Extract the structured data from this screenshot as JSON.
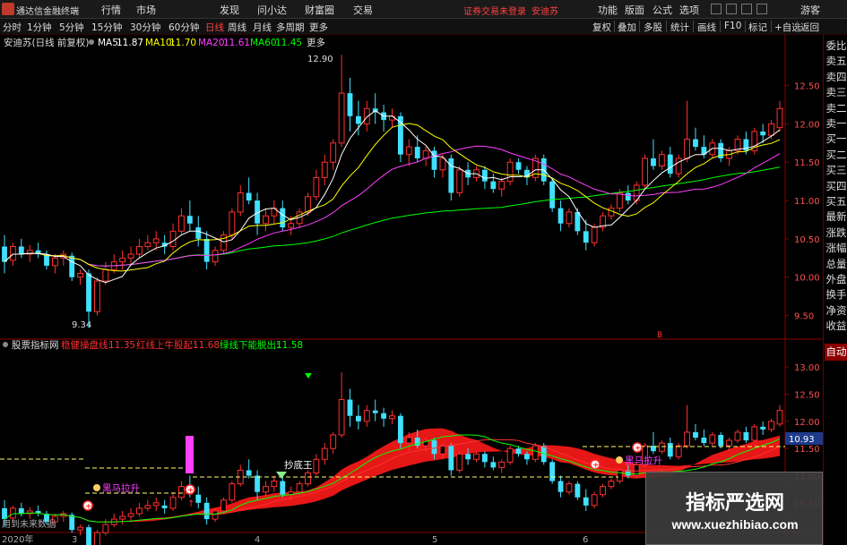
{
  "menubar": {
    "app_name": "通达信金融终端",
    "items": [
      "行情",
      "市场",
      "发现",
      "问小达",
      "财富圈",
      "交易"
    ],
    "notice": "证券交易未登录",
    "stock_name": "安迪苏",
    "right_items": [
      "功能",
      "版面",
      "公式",
      "选项"
    ],
    "guest": "游客"
  },
  "toolbar": {
    "timeframes": [
      "分时",
      "1分钟",
      "5分钟",
      "15分钟",
      "30分钟",
      "60分钟",
      "日线",
      "周线",
      "月线",
      "多周期",
      "更多"
    ],
    "active": "日线",
    "buttons": [
      "复权",
      "叠加",
      "多股",
      "统计",
      "画线",
      "F10",
      "标记",
      "+自选",
      "返回"
    ]
  },
  "main_chart": {
    "title": "安迪苏(日线 前复权)",
    "ma": [
      {
        "label": "MA5:",
        "value": "11.87",
        "color": "#ffffff"
      },
      {
        "label": "MA10:",
        "value": "11.70",
        "color": "#ffff00"
      },
      {
        "label": "MA20:",
        "value": "11.61",
        "color": "#ff40ff"
      },
      {
        "label": "MA60:",
        "value": "11.45",
        "color": "#00ff00"
      }
    ],
    "high_label": "12.90",
    "low_label": "9.34",
    "y_ticks": [
      "12.50",
      "12.00",
      "11.50",
      "11.00",
      "10.50",
      "10.00",
      "9.50"
    ],
    "marker": "B"
  },
  "indicator": {
    "title": "股票指标网",
    "lines": [
      {
        "label": "稳健操盘线:",
        "value": "11.35",
        "color": "#ff3030"
      },
      {
        "label": "红线上牛股起:",
        "value": "11.68",
        "color": "#ff3030"
      },
      {
        "label": "绿线下能脱出:",
        "value": "11.58",
        "color": "#00ff00"
      }
    ],
    "y_ticks": [
      "13.00",
      "12.50",
      "12.00",
      "11.50",
      "11.00",
      "10.50"
    ],
    "current_value": "10.93",
    "signals": [
      "抄底王",
      "黑马拉升",
      "黑马拉升"
    ]
  },
  "footer": {
    "note": "用到未来数据",
    "year": "2020年",
    "months": [
      "3",
      "4",
      "5",
      "6"
    ]
  },
  "right_panel": [
    "委比",
    "卖五",
    "卖四",
    "卖三",
    "卖二",
    "卖一",
    "买一",
    "买二",
    "买三",
    "买四",
    "买五",
    "最新",
    "涨跌",
    "涨幅",
    "总量",
    "外盘",
    "换手",
    "净资",
    "收益",
    "自动"
  ],
  "watermark": {
    "title": "指标严选网",
    "url": "www.xuezhibiao.com"
  },
  "colors": {
    "up": "#ff3030",
    "down": "#40e0ff",
    "ma5": "#ffffff",
    "ma10": "#ffff00",
    "ma20": "#ff40ff",
    "ma60": "#00ff00"
  },
  "chart_data": {
    "type": "candlestick",
    "ohlc": [
      [
        10.4,
        10.55,
        10.05,
        10.2
      ],
      [
        10.22,
        10.45,
        10.15,
        10.4
      ],
      [
        10.4,
        10.5,
        10.25,
        10.3
      ],
      [
        10.3,
        10.42,
        10.2,
        10.35
      ],
      [
        10.35,
        10.45,
        10.25,
        10.3
      ],
      [
        10.3,
        10.35,
        10.1,
        10.15
      ],
      [
        10.15,
        10.3,
        10.05,
        10.25
      ],
      [
        10.25,
        10.35,
        10.15,
        10.3
      ],
      [
        10.28,
        10.32,
        9.95,
        10.0
      ],
      [
        10.0,
        10.1,
        9.9,
        10.05
      ],
      [
        10.05,
        10.1,
        9.34,
        9.55
      ],
      [
        9.55,
        10.0,
        9.5,
        9.95
      ],
      [
        9.95,
        10.2,
        9.9,
        10.1
      ],
      [
        10.1,
        10.3,
        10.05,
        10.2
      ],
      [
        10.2,
        10.35,
        10.1,
        10.25
      ],
      [
        10.25,
        10.4,
        10.15,
        10.3
      ],
      [
        10.3,
        10.5,
        10.25,
        10.4
      ],
      [
        10.4,
        10.55,
        10.35,
        10.45
      ],
      [
        10.45,
        10.6,
        10.35,
        10.5
      ],
      [
        10.45,
        10.55,
        10.3,
        10.4
      ],
      [
        10.4,
        10.7,
        10.35,
        10.6
      ],
      [
        10.6,
        10.9,
        10.55,
        10.8
      ],
      [
        10.8,
        11.0,
        10.6,
        10.7
      ],
      [
        10.65,
        10.8,
        10.4,
        10.5
      ],
      [
        10.5,
        10.6,
        10.1,
        10.2
      ],
      [
        10.2,
        10.4,
        10.15,
        10.35
      ],
      [
        10.35,
        10.6,
        10.3,
        10.55
      ],
      [
        10.55,
        10.9,
        10.5,
        10.85
      ],
      [
        10.85,
        11.2,
        10.8,
        11.1
      ],
      [
        11.1,
        11.3,
        10.95,
        11.0
      ],
      [
        11.0,
        11.1,
        10.55,
        10.7
      ],
      [
        10.7,
        10.9,
        10.6,
        10.8
      ],
      [
        10.8,
        11.0,
        10.7,
        10.9
      ],
      [
        10.9,
        11.0,
        10.6,
        10.65
      ],
      [
        10.65,
        10.8,
        10.55,
        10.7
      ],
      [
        10.7,
        10.9,
        10.65,
        10.85
      ],
      [
        10.85,
        11.1,
        10.8,
        11.05
      ],
      [
        11.05,
        11.4,
        11.0,
        11.3
      ],
      [
        11.3,
        11.6,
        11.2,
        11.5
      ],
      [
        11.5,
        11.8,
        11.4,
        11.75
      ],
      [
        11.75,
        12.9,
        11.7,
        12.4
      ],
      [
        12.4,
        12.6,
        11.9,
        12.1
      ],
      [
        12.1,
        12.3,
        11.85,
        12.0
      ],
      [
        12.0,
        12.3,
        11.9,
        12.2
      ],
      [
        12.2,
        12.4,
        12.0,
        12.15
      ],
      [
        12.15,
        12.25,
        11.9,
        12.05
      ],
      [
        12.05,
        12.2,
        11.95,
        12.1
      ],
      [
        12.1,
        12.15,
        11.5,
        11.6
      ],
      [
        11.6,
        11.8,
        11.45,
        11.7
      ],
      [
        11.7,
        11.85,
        11.5,
        11.55
      ],
      [
        11.55,
        11.7,
        11.45,
        11.65
      ],
      [
        11.65,
        11.7,
        11.3,
        11.4
      ],
      [
        11.4,
        11.6,
        11.3,
        11.55
      ],
      [
        11.55,
        11.6,
        11.0,
        11.1
      ],
      [
        11.1,
        11.45,
        11.05,
        11.4
      ],
      [
        11.4,
        11.5,
        11.2,
        11.3
      ],
      [
        11.3,
        11.45,
        11.25,
        11.4
      ],
      [
        11.4,
        11.45,
        11.15,
        11.25
      ],
      [
        11.25,
        11.35,
        11.1,
        11.15
      ],
      [
        11.15,
        11.3,
        11.05,
        11.25
      ],
      [
        11.25,
        11.55,
        11.2,
        11.5
      ],
      [
        11.5,
        11.55,
        11.35,
        11.4
      ],
      [
        11.4,
        11.45,
        11.2,
        11.3
      ],
      [
        11.3,
        11.6,
        11.25,
        11.55
      ],
      [
        11.55,
        11.6,
        11.2,
        11.25
      ],
      [
        11.25,
        11.3,
        10.85,
        10.9
      ],
      [
        10.9,
        11.0,
        10.6,
        10.7
      ],
      [
        10.7,
        10.9,
        10.65,
        10.85
      ],
      [
        10.85,
        10.9,
        10.55,
        10.6
      ],
      [
        10.6,
        10.75,
        10.35,
        10.45
      ],
      [
        10.45,
        10.7,
        10.4,
        10.65
      ],
      [
        10.65,
        10.85,
        10.6,
        10.8
      ],
      [
        10.8,
        10.95,
        10.75,
        10.9
      ],
      [
        10.9,
        11.15,
        10.85,
        11.1
      ],
      [
        11.1,
        11.2,
        10.95,
        11.0
      ],
      [
        11.0,
        11.25,
        10.95,
        11.2
      ],
      [
        11.2,
        11.6,
        11.15,
        11.55
      ],
      [
        11.55,
        11.8,
        11.4,
        11.45
      ],
      [
        11.45,
        11.65,
        11.4,
        11.6
      ],
      [
        11.6,
        11.7,
        11.3,
        11.35
      ],
      [
        11.35,
        11.6,
        11.3,
        11.55
      ],
      [
        11.55,
        12.3,
        11.5,
        11.8
      ],
      [
        11.8,
        11.95,
        11.65,
        11.7
      ],
      [
        11.7,
        11.85,
        11.55,
        11.6
      ],
      [
        11.6,
        11.8,
        11.55,
        11.75
      ],
      [
        11.75,
        11.8,
        11.5,
        11.55
      ],
      [
        11.55,
        11.7,
        11.45,
        11.65
      ],
      [
        11.65,
        11.85,
        11.6,
        11.8
      ],
      [
        11.8,
        11.9,
        11.6,
        11.65
      ],
      [
        11.65,
        11.95,
        11.6,
        11.9
      ],
      [
        11.9,
        12.0,
        11.75,
        11.85
      ],
      [
        11.85,
        12.05,
        11.8,
        12.0
      ],
      [
        11.95,
        12.3,
        11.9,
        12.2
      ]
    ],
    "ylim": [
      9.25,
      12.95
    ]
  }
}
